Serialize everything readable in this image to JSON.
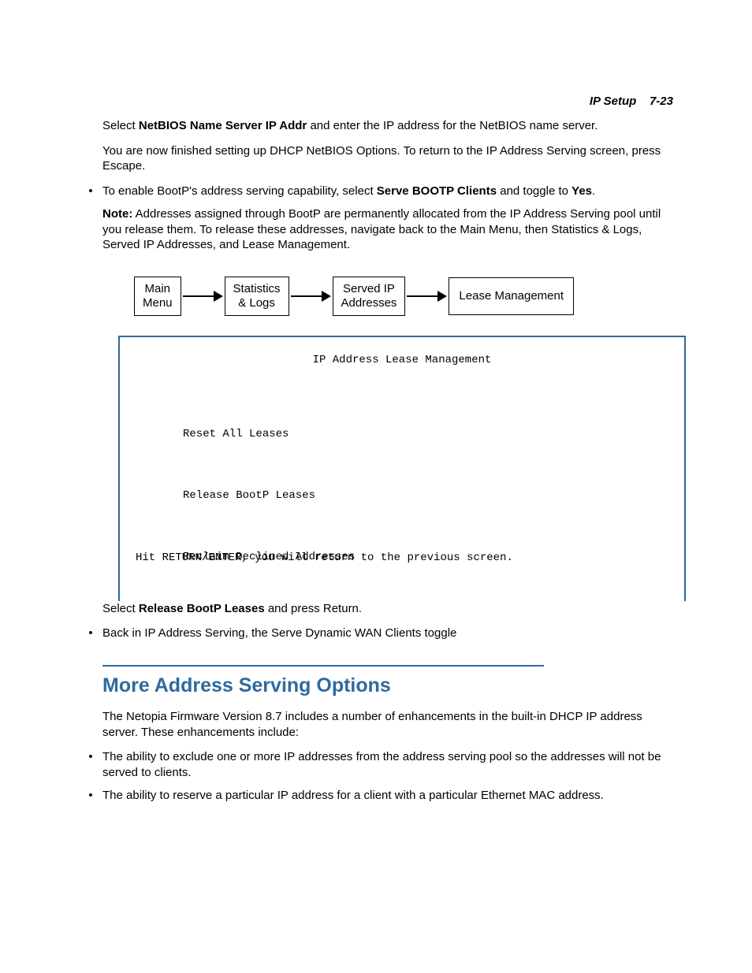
{
  "header": {
    "section": "IP Setup",
    "page": "7-23"
  },
  "para1": {
    "pre": "Select ",
    "bold": "NetBIOS Name Server IP Addr",
    "post": " and enter the IP address for the NetBIOS name server."
  },
  "para2": "You are now finished setting up DHCP NetBIOS Options. To return to the IP Address Serving screen, press Escape.",
  "bullet1": {
    "pre": "To enable BootP's address serving capability, select ",
    "b1": "Serve BOOTP Clients",
    "mid": " and toggle to ",
    "b2": "Yes",
    "post": "."
  },
  "note": {
    "label": "Note:",
    "text": "  Addresses assigned through BootP are permanently allocated from the IP Address Serving pool until you release them. To release these addresses, navigate back to the Main Menu, then Statistics & Logs, Served IP Addresses, and Lease Management."
  },
  "flow": {
    "b1": "Main\nMenu",
    "b2": "Statistics\n& Logs",
    "b3": "Served IP\nAddresses",
    "b4": "Lease Management"
  },
  "panel": {
    "title": "IP Address Lease Management",
    "items": [
      "Reset All Leases",
      "Release BootP Leases",
      "Reclaim Declined Addresses"
    ],
    "footer": "Hit RETURN/ENTER, you will return to the previous screen."
  },
  "after1": {
    "pre": "Select ",
    "bold": "Release BootP Leases",
    "post": " and press Return."
  },
  "after2": "Back in IP Address Serving, the Serve Dynamic WAN Clients toggle",
  "section": {
    "title": "More Address Serving Options",
    "intro": "The Netopia Firmware Version 8.7 includes a number of enhancements in the built-in DHCP IP address server. These enhancements include:",
    "bullets": [
      "The ability to exclude one or more IP addresses from the address serving pool so the addresses will not be served to clients.",
      "The ability to reserve a particular IP address for a client with a particular Ethernet MAC address."
    ]
  },
  "glyphs": {
    "bullet": "•"
  }
}
